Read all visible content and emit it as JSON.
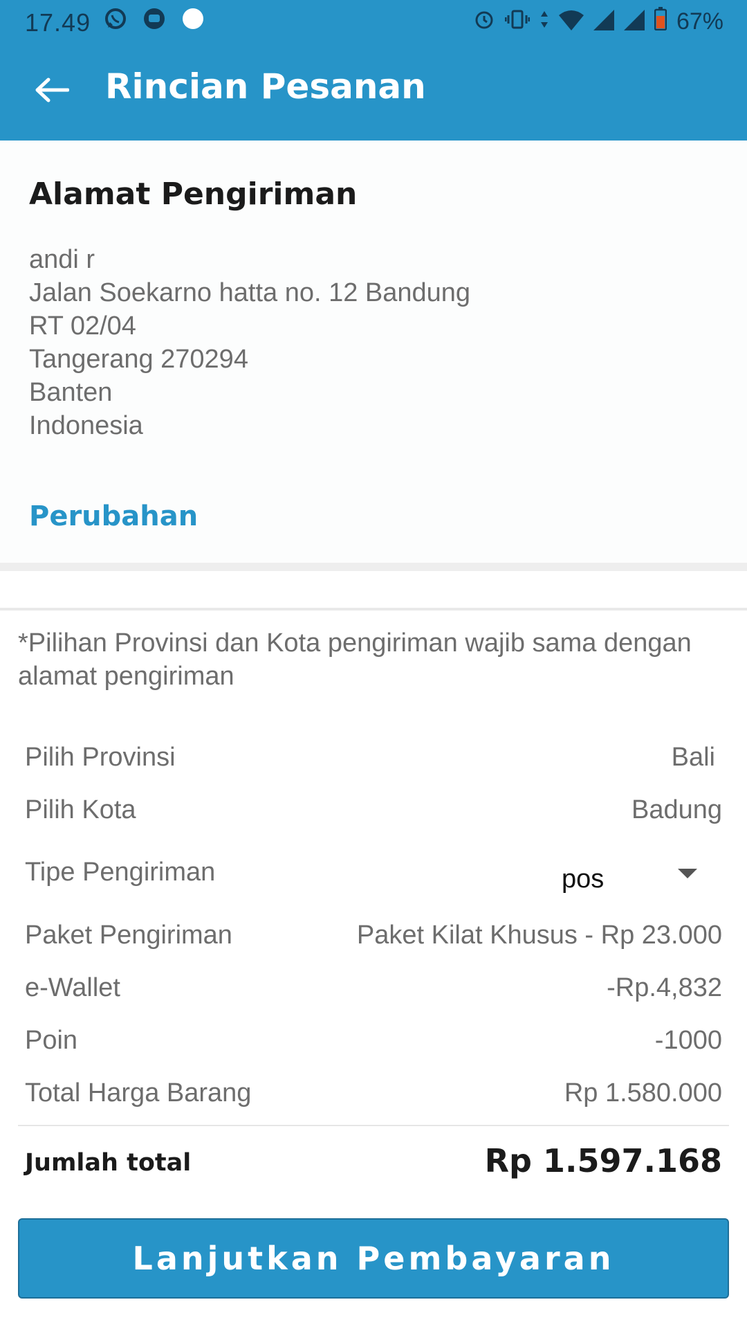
{
  "status_bar": {
    "time": "17.49",
    "battery_percent": "67%",
    "left_icons": [
      "whatsapp-icon",
      "chat-bubble-icon",
      "dot-icon"
    ],
    "right_icons": [
      "alarm-icon",
      "vibrate-icon",
      "data-arrows-icon",
      "wifi-icon",
      "signal-icon",
      "signal-icon",
      "battery-icon"
    ]
  },
  "app_bar": {
    "title": "Rincian Pesanan",
    "back_icon": "arrow-left-icon"
  },
  "address": {
    "heading": "Alamat Pengiriman",
    "lines": [
      "andi r",
      "Jalan Soekarno hatta no. 12 Bandung",
      "RT 02/04",
      "Tangerang 270294",
      "Banten",
      "Indonesia"
    ],
    "change_link": "Perubahan"
  },
  "shipping": {
    "note": "*Pilihan Provinsi dan Kota pengiriman wajib sama dengan alamat pengiriman",
    "province": {
      "label": "Pilih Provinsi",
      "value": "Bali"
    },
    "city": {
      "label": "Pilih Kota",
      "value": "Badung"
    },
    "shipping_type": {
      "label": "Tipe Pengiriman",
      "selected": "pos"
    },
    "package": {
      "label": "Paket Pengiriman",
      "value": "Paket Kilat Khusus - Rp 23.000"
    },
    "ewallet": {
      "label": "e-Wallet",
      "value": "-Rp.4,832"
    },
    "points": {
      "label": "Poin",
      "value": "-1000"
    },
    "goods_total": {
      "label": "Total Harga Barang",
      "value": "Rp 1.580.000"
    }
  },
  "summary": {
    "label": "Jumlah total",
    "value": "Rp 1.597.168"
  },
  "actions": {
    "pay_button": "Lanjutkan Pembayaran"
  },
  "colors": {
    "primary": "#2794c8",
    "text_dark": "#1b1b1b",
    "text_muted": "#6d6d6d"
  }
}
